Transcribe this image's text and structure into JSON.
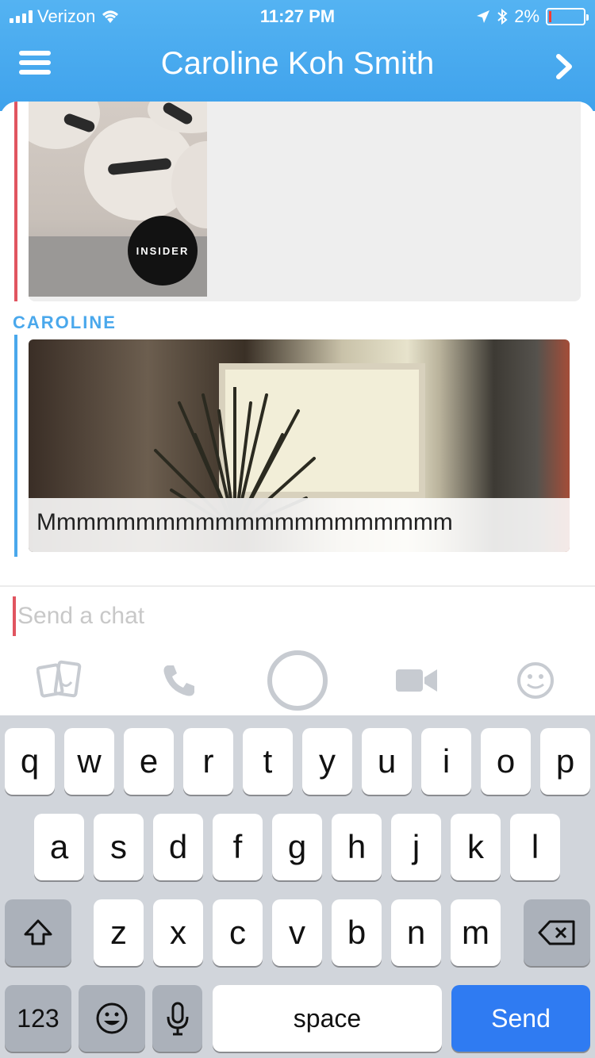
{
  "status": {
    "carrier": "Verizon",
    "time": "11:27 PM",
    "battery_percent": "2%",
    "battery_level": 0.02,
    "icons": [
      "signal-icon",
      "wifi-icon",
      "location-arrow-icon",
      "bluetooth-icon",
      "battery-icon"
    ]
  },
  "header": {
    "title": "Caroline Koh Smith",
    "menu_icon": "hamburger-menu-icon",
    "forward_icon": "chevron-right-icon"
  },
  "messages": [
    {
      "bar_color": "#e15560",
      "image": "insider-story-thumbnail",
      "logo_text": "INSIDER"
    },
    {
      "sender": "CAROLINE",
      "bar_color": "#4aa8ec",
      "image": "window-plant-snap",
      "caption": "Mmmmmmmmmmmmmmmmmmmmm"
    }
  ],
  "composer": {
    "placeholder": "Send a chat",
    "value": ""
  },
  "tools": [
    "stickers-icon",
    "phone-icon",
    "capture-button",
    "video-camera-icon",
    "emoji-icon"
  ],
  "keyboard": {
    "row1": [
      "q",
      "w",
      "e",
      "r",
      "t",
      "y",
      "u",
      "i",
      "o",
      "p"
    ],
    "row2": [
      "a",
      "s",
      "d",
      "f",
      "g",
      "h",
      "j",
      "k",
      "l"
    ],
    "row3": [
      "z",
      "x",
      "c",
      "v",
      "b",
      "n",
      "m"
    ],
    "numbers_label": "123",
    "space_label": "space",
    "send_label": "Send",
    "accent": "#2f7bf2"
  }
}
